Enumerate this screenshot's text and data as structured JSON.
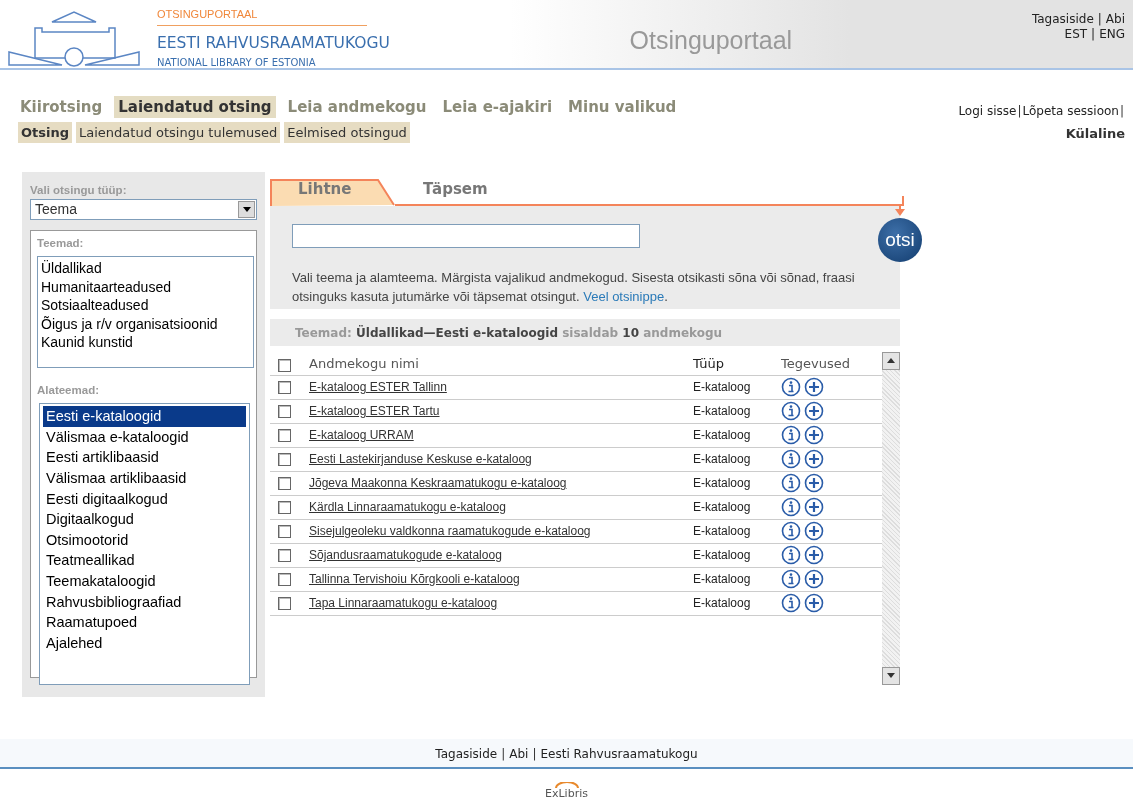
{
  "header": {
    "kicker": "OTSINGUPORTAAL",
    "title": "EESTI RAHVUSRAAMATUKOGU",
    "subtitle": "NATIONAL LIBRARY OF ESTONIA",
    "portal_title": "Otsinguportaal",
    "top_links": [
      {
        "kind": "link",
        "text": "Tagasiside"
      },
      {
        "kind": "separator",
        "text": "|"
      },
      {
        "kind": "link",
        "text": "Abi"
      }
    ],
    "languages": [
      {
        "kind": "link",
        "text": "EST"
      },
      {
        "kind": "separator",
        "text": "|"
      },
      {
        "kind": "link",
        "text": "ENG"
      }
    ]
  },
  "primary_tabs": [
    {
      "label": "Kiirotsing",
      "selected": false
    },
    {
      "label": "Laiendatud otsing",
      "selected": true
    },
    {
      "label": "Leia andmekogu",
      "selected": false
    },
    {
      "label": "Leia e-ajakiri",
      "selected": false
    },
    {
      "label": "Minu valikud",
      "selected": false
    }
  ],
  "secondary_tabs": [
    {
      "label": "Otsing",
      "selected": true
    },
    {
      "label": "Laiendatud otsingu tulemused",
      "selected": false
    },
    {
      "label": "Eelmised otsingud",
      "selected": false
    }
  ],
  "session_links": [
    {
      "kind": "link",
      "text": "Logi sisse"
    },
    {
      "kind": "separator",
      "text": "|"
    },
    {
      "kind": "link",
      "text": "Lõpeta sessioon"
    },
    {
      "kind": "separator",
      "text": "|"
    }
  ],
  "user": "Külaline",
  "sidebar": {
    "search_type": {
      "label": "Vali otsingu tüüp:",
      "value": "Teema"
    },
    "topics": {
      "label": "Teemad:",
      "items": [
        {
          "label": "Üldallikad",
          "selected": false
        },
        {
          "label": "Humanitaarteadused",
          "selected": false
        },
        {
          "label": "Sotsiaalteadused",
          "selected": false
        },
        {
          "label": "Õigus ja r/v organisatsioonid",
          "selected": false
        },
        {
          "label": "Kaunid kunstid",
          "selected": false
        }
      ]
    },
    "subtopics": {
      "label": "Alateemad:",
      "items": [
        {
          "label": "Eesti e-kataloogid",
          "selected": true
        },
        {
          "label": "Välismaa e-kataloogid",
          "selected": false
        },
        {
          "label": "Eesti artiklibaasid",
          "selected": false
        },
        {
          "label": "Välismaa artiklibaasid",
          "selected": false
        },
        {
          "label": "Eesti digitaalkogud",
          "selected": false
        },
        {
          "label": "Digitaalkogud",
          "selected": false
        },
        {
          "label": "Otsimootorid",
          "selected": false
        },
        {
          "label": "Teatmeallikad",
          "selected": false
        },
        {
          "label": "Teemakataloogid",
          "selected": false
        },
        {
          "label": "Rahvusbibliograafiad",
          "selected": false
        },
        {
          "label": "Raamatupoed",
          "selected": false
        },
        {
          "label": "Ajalehed",
          "selected": false
        }
      ]
    }
  },
  "search": {
    "tabs": [
      {
        "label": "Lihtne",
        "selected": true
      },
      {
        "label": "Täpsem",
        "selected": false
      }
    ],
    "button": "otsi",
    "help": {
      "text": "Vali teema ja alamteema. Märgista vajalikud andmekogud. Sisesta otsikasti sõna või sõnad, fraasi otsinguks kasuta jutumärke või täpsemat otsingut. ",
      "link": "Veel otsinippe",
      "after": "."
    }
  },
  "summary": "Teemad: **Üldallikad—Eesti e-kataloogid** sisaldab **10** andmekogu",
  "table": {
    "select_all": false,
    "columns": [
      "Andmekogu nimi",
      "Tüüp",
      "Tegevused"
    ],
    "rows": [
      {
        "name": "E-kataloog ESTER Tallinn",
        "type": "E-kataloog",
        "checked": false
      },
      {
        "name": "E-kataloog ESTER Tartu",
        "type": "E-kataloog",
        "checked": false
      },
      {
        "name": "E-kataloog URRAM",
        "type": "E-kataloog",
        "checked": false
      },
      {
        "name": "Eesti Lastekirjanduse Keskuse e-kataloog",
        "type": "E-kataloog",
        "checked": false
      },
      {
        "name": "Jõgeva Maakonna Keskraamatukogu e-kataloog",
        "type": "E-kataloog",
        "checked": false
      },
      {
        "name": "Kärdla Linnaraamatukogu e-kataloog",
        "type": "E-kataloog",
        "checked": false
      },
      {
        "name": "Sisejulgeoleku valdkonna raamatukogude e-kataloog",
        "type": "E-kataloog",
        "checked": false
      },
      {
        "name": "Sõjandusraamatukogude e-kataloog",
        "type": "E-kataloog",
        "checked": false
      },
      {
        "name": "Tallinna Tervishoiu Kõrgkooli e-kataloog",
        "type": "E-kataloog",
        "checked": false
      },
      {
        "name": "Tapa Linnaraamatukogu e-kataloog",
        "type": "E-kataloog",
        "checked": false
      }
    ]
  },
  "footer": {
    "links": [
      {
        "kind": "link",
        "text": "Tagasiside"
      },
      {
        "kind": "separator",
        "text": "|"
      },
      {
        "kind": "link",
        "text": "Abi"
      },
      {
        "kind": "separator",
        "text": "|"
      },
      {
        "kind": "link",
        "text": "Eesti Rahvusraamatukogu"
      }
    ],
    "vendor": "ExLibris"
  }
}
